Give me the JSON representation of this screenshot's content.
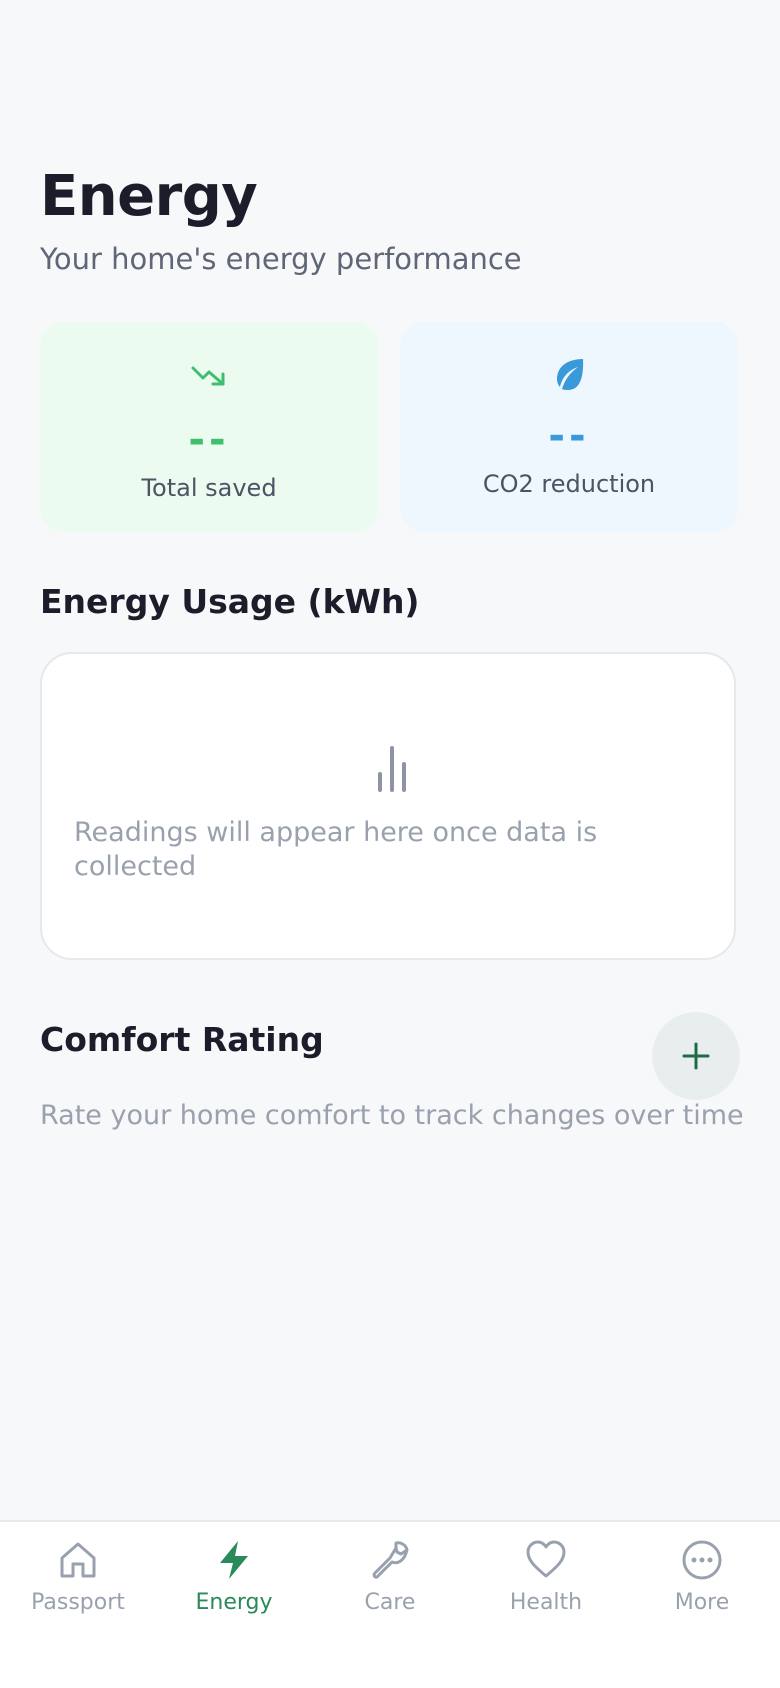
{
  "header": {
    "title": "Energy",
    "subtitle": "Your home's energy performance"
  },
  "stats": {
    "saved": {
      "value": "--",
      "label": "Total saved",
      "icon": "trending-down-icon",
      "color": "#3fbf6e"
    },
    "co2": {
      "value": "--",
      "label": "CO2 reduction",
      "icon": "leaf-icon",
      "color": "#3a9ad9"
    }
  },
  "usage": {
    "title": "Energy Usage (kWh)",
    "empty_icon": "bar-chart-icon",
    "empty_text": "Readings will appear here once data is collected"
  },
  "comfort": {
    "title": "Comfort Rating",
    "add_icon": "plus-icon",
    "hint": "Rate your home comfort to track changes over time"
  },
  "tabbar": {
    "active": "Energy",
    "accent": "#2a8a5a",
    "items": [
      {
        "label": "Passport",
        "icon": "house-icon"
      },
      {
        "label": "Energy",
        "icon": "lightning-icon"
      },
      {
        "label": "Care",
        "icon": "wrench-icon"
      },
      {
        "label": "Health",
        "icon": "heart-icon"
      },
      {
        "label": "More",
        "icon": "more-dots-icon"
      }
    ]
  }
}
